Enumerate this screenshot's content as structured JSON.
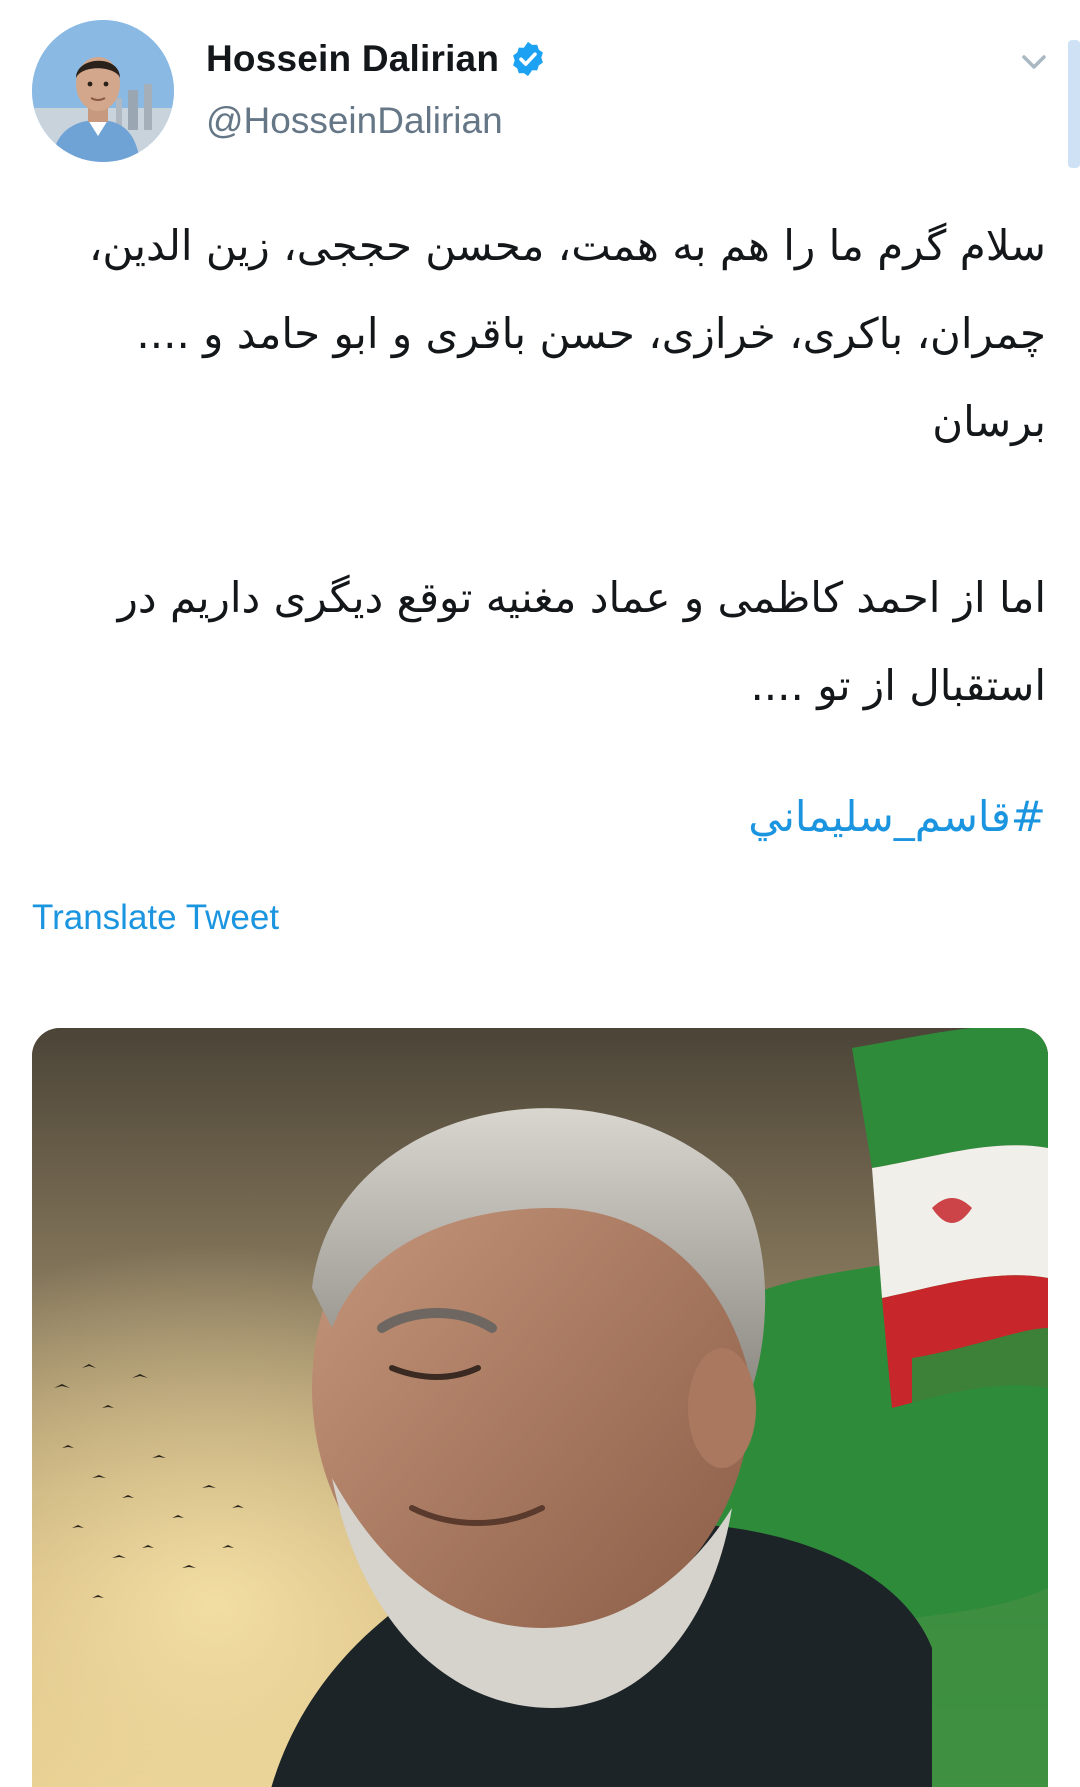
{
  "author": {
    "display_name": "Hossein Dalirian",
    "handle": "@HosseinDalirian",
    "verified": true
  },
  "tweet": {
    "paragraphs": [
      "سلام گرم ما را هم به همت، محسن حججی، زین الدین، چمران، باکری، خرازی، حسن باقری و ابو حامد و .... برسان",
      "اما از احمد کاظمی و عماد مغنیه توقع دیگری داریم در استقبال از تو ...."
    ],
    "hashtag": "#قاسم_سليماني",
    "translate_label": "Translate Tweet"
  },
  "colors": {
    "link": "#1b95e0",
    "secondary_text": "#657786",
    "primary_text": "#14171a"
  },
  "icons": {
    "verified": "verified-badge-icon",
    "caret": "chevron-down-icon"
  }
}
